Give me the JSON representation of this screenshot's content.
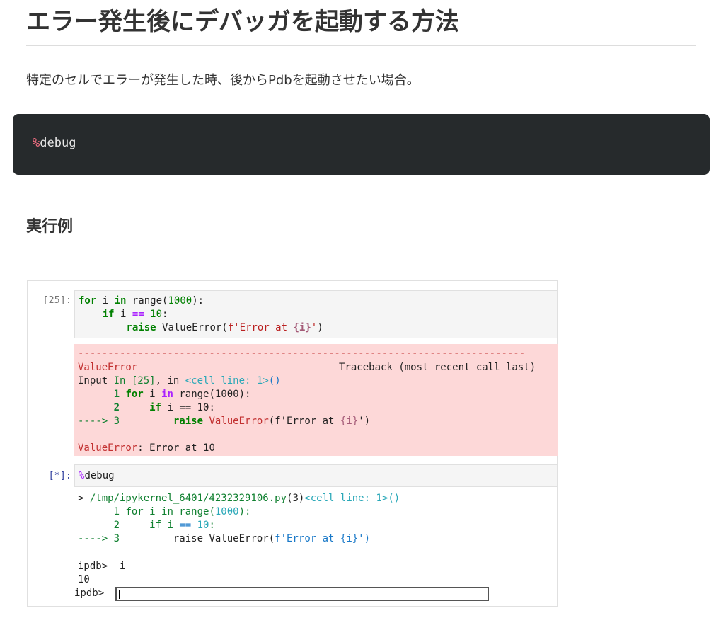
{
  "heading": "エラー発生後にデバッガを起動する方法",
  "intro": "特定のセルでエラーが発生した時、後からPdbを起動させたい場合。",
  "code_block": {
    "prefix": "%",
    "command": "debug"
  },
  "section_title": "実行例",
  "notebook": {
    "cell1": {
      "prompt": "[25]:",
      "l1": {
        "k1": "for",
        "t1": " i ",
        "k2": "in",
        "t2": " range(",
        "n": "1000",
        "t3": "):"
      },
      "l2": {
        "indent": "    ",
        "k": "if",
        "t1": " i ",
        "op": "==",
        "t2": " ",
        "n": "10",
        "t3": ":"
      },
      "l3": {
        "indent": "        ",
        "k": "raise",
        "t1": " ValueError(",
        "s1": "f'Error at ",
        "b": "{i}",
        "s2": "'",
        "t2": ")"
      }
    },
    "error": {
      "dashes": "---------------------------------------------------------------------------",
      "ename": "ValueError",
      "tb": "Traceback (most recent call last)",
      "input": "Input ",
      "in_label": "In [25]",
      "in_sep": ", in ",
      "cell_ref": "<cell line: 1>",
      "cell_ref_end": "()",
      "r1": {
        "lead": "      ",
        "num": "1",
        "sp": " ",
        "k1": "for",
        "t1": " i ",
        "k2": "in",
        "t2": " range(1000):"
      },
      "r2": {
        "lead": "      ",
        "num": "2",
        "sp": "     ",
        "k": "if",
        "t": " i == 10:"
      },
      "r3": {
        "arrow": "----> 3",
        "sp": "         ",
        "k": "raise",
        "sp2": " ",
        "e": "ValueError",
        "t1": "(f'Error at ",
        "b": "{i}",
        "t2": "')"
      },
      "final_name": "ValueError",
      "final_msg": ": Error at 10"
    },
    "cell2": {
      "prompt": "[*]:",
      "prefix": "%",
      "command": "debug"
    },
    "debug_out": {
      "loc_arrow": "> ",
      "loc_path": "/tmp/ipykernel_6401/4232329106.py",
      "loc_line": "(3)",
      "loc_cell": "<cell line: 1>()",
      "r1": {
        "lead": "      1 ",
        "t1": "for i in range(",
        "n": "1000",
        "t2": "):"
      },
      "r2": {
        "lead": "      2     ",
        "t1": "if i ",
        "op": "==",
        "t2": " ",
        "n": "10",
        "t3": ":"
      },
      "r3": {
        "arrow": "----> 3",
        "sp": "         ",
        "t1": "raise ValueError(",
        "s": "f'Error at {i}'",
        "t2": ")"
      },
      "p1": "ipdb>  i",
      "out": "10",
      "p2": "ipdb>"
    }
  }
}
